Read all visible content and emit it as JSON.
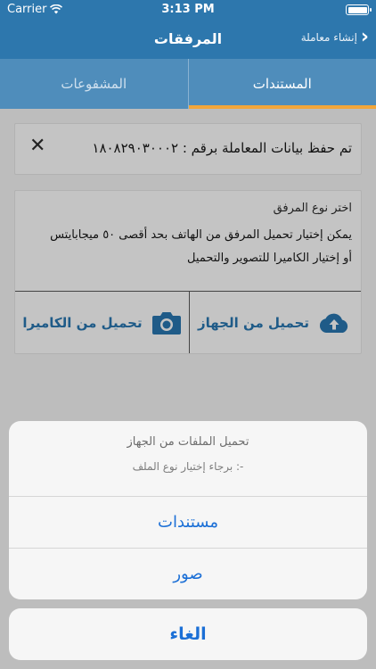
{
  "status": {
    "carrier": "Carrier",
    "time": "3:13 PM"
  },
  "nav": {
    "title": "المرفقات",
    "back_label": "إنشاء معاملة"
  },
  "tabs": [
    {
      "label": "المستندات",
      "active": true
    },
    {
      "label": "المشفوعات",
      "active": false
    }
  ],
  "save_card": {
    "message": "تم حفظ بيانات المعاملة برقم : ١٨٠٨٢٩٠٣٠٠٠٢"
  },
  "upload_card": {
    "heading": "اختر نوع المرفق",
    "desc_line1": "يمكن إختيار تحميل المرفق من الهاتف بحد أقصى ٥٠ ميجابايتس",
    "desc_line2": "أو إختيار الكاميرا للتصوير والتحميل",
    "device_label": "تحميل من الجهاز",
    "camera_label": "تحميل من الكاميرا"
  },
  "action_sheet": {
    "title": "تحميل الملفات من الجهاز",
    "subtitle": "برجاء إختيار نوع الملف :-",
    "options": [
      "مستندات",
      "صور"
    ],
    "cancel_label": "الغاء"
  },
  "colors": {
    "nav": "#2d77ad",
    "tab_bar": "#4f8dbb",
    "tab_indicator": "#f2a63a",
    "action_blue": "#1b6fd6",
    "icon_blue": "#1f5b88"
  }
}
